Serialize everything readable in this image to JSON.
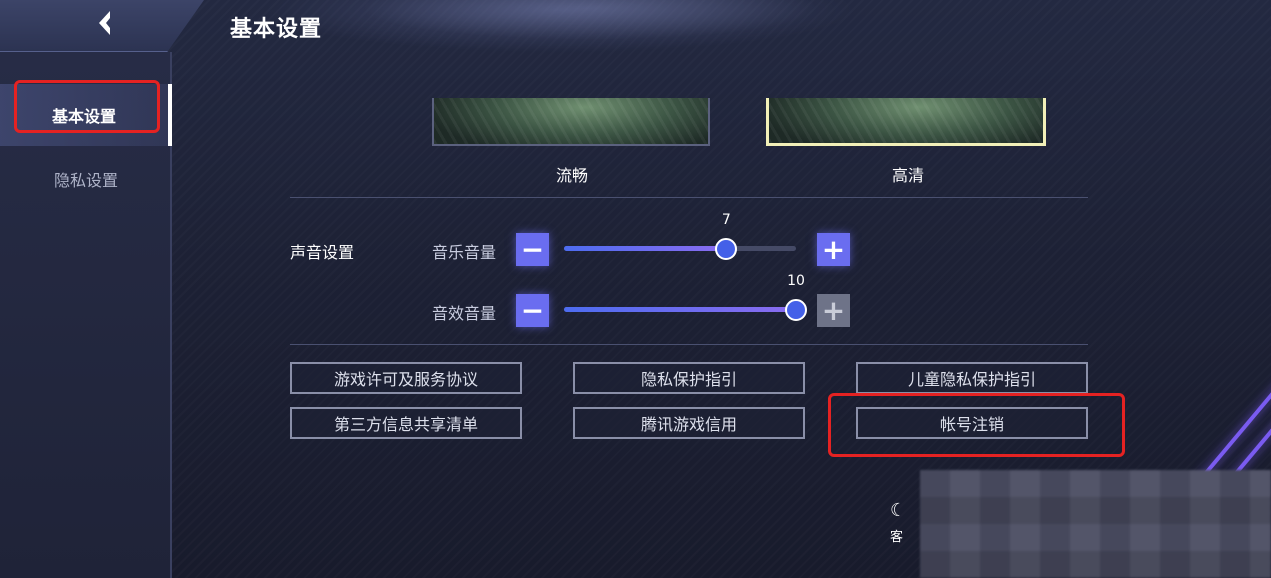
{
  "header": {
    "title": "基本设置",
    "back_icon": "back-arrow-icon"
  },
  "sidebar": {
    "items": [
      {
        "label": "基本设置",
        "active": true
      },
      {
        "label": "隐私设置",
        "active": false
      }
    ]
  },
  "graphics": {
    "options": [
      {
        "label": "流畅",
        "selected": false
      },
      {
        "label": "高清",
        "selected": true
      }
    ]
  },
  "sound": {
    "section_label": "声音设置",
    "music": {
      "label": "音乐音量",
      "value": "7",
      "level": 7,
      "max": 10,
      "minus": "−",
      "plus": "+"
    },
    "effects": {
      "label": "音效音量",
      "value": "10",
      "level": 10,
      "max": 10,
      "minus": "−",
      "plus": "+"
    }
  },
  "links": [
    "游戏许可及服务协议",
    "隐私保护指引",
    "儿童隐私保护指引",
    "第三方信息共享清单",
    "腾讯游戏信用",
    "帐号注销"
  ],
  "customer_service": {
    "label": "客",
    "icon": "customer-service-icon"
  },
  "colors": {
    "accent": "#6a6df0",
    "highlight": "#e52222",
    "selected_border": "#f2f0b8"
  }
}
